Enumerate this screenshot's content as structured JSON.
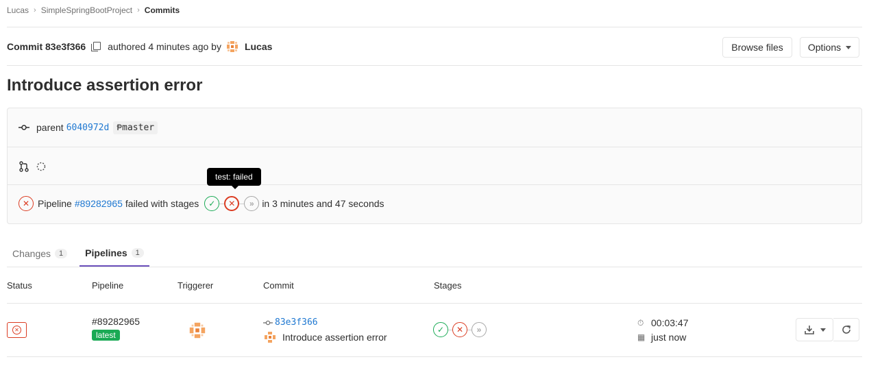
{
  "breadcrumb": {
    "items": [
      "Lucas",
      "SimpleSpringBootProject"
    ],
    "current": "Commits"
  },
  "commit_header": {
    "label": "Commit 83e3f366",
    "authored": "authored 4 minutes ago by",
    "author": "Lucas",
    "browse_files": "Browse files",
    "options": "Options"
  },
  "title": "Introduce assertion error",
  "info": {
    "parent_label": "parent",
    "parent_sha": "6040972d",
    "branch": "master",
    "pipeline_prefix": "Pipeline",
    "pipeline_id": "#89282965",
    "pipeline_status_text": "failed with stages",
    "duration_text": "in 3 minutes and 47 seconds",
    "stages": [
      "success",
      "failed",
      "skipped"
    ]
  },
  "tooltip": "test: failed",
  "tabs": [
    {
      "label": "Changes",
      "count": "1",
      "active": false
    },
    {
      "label": "Pipelines",
      "count": "1",
      "active": true
    }
  ],
  "table": {
    "headers": [
      "Status",
      "Pipeline",
      "Triggerer",
      "Commit",
      "Stages"
    ],
    "row": {
      "pipeline_id": "#89282965",
      "badge": "latest",
      "commit_sha": "83e3f366",
      "commit_title": "Introduce assertion error",
      "duration": "00:03:47",
      "finished": "just now"
    }
  },
  "colors": {
    "link": "#1f78d1",
    "success": "#1aaa55",
    "failed": "#db3b21",
    "skipped": "#a7a7a7",
    "tab_active": "#6b4fbb"
  }
}
